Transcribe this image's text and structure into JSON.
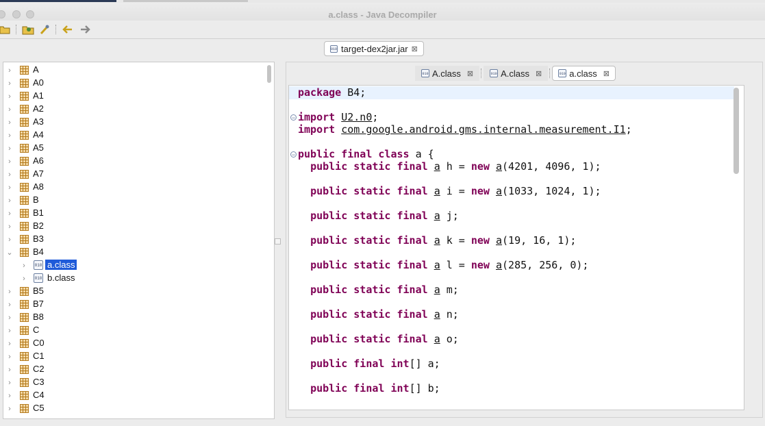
{
  "window": {
    "title": "a.class - Java Decompiler"
  },
  "toolbar": {
    "icons": [
      "open-folder-icon",
      "open-type-icon",
      "open-type-hierarchy-icon",
      "back-arrow-icon",
      "forward-arrow-icon"
    ]
  },
  "file_tab": {
    "label": "target-dex2jar.jar",
    "icon": "jar-icon"
  },
  "tree": {
    "items": [
      {
        "label": "A",
        "expanded": false
      },
      {
        "label": "A0",
        "expanded": false
      },
      {
        "label": "A1",
        "expanded": false
      },
      {
        "label": "A2",
        "expanded": false
      },
      {
        "label": "A3",
        "expanded": false
      },
      {
        "label": "A4",
        "expanded": false
      },
      {
        "label": "A5",
        "expanded": false
      },
      {
        "label": "A6",
        "expanded": false
      },
      {
        "label": "A7",
        "expanded": false
      },
      {
        "label": "A8",
        "expanded": false
      },
      {
        "label": "B",
        "expanded": false
      },
      {
        "label": "B1",
        "expanded": false
      },
      {
        "label": "B2",
        "expanded": false
      },
      {
        "label": "B3",
        "expanded": false
      },
      {
        "label": "B4",
        "expanded": true
      },
      {
        "label": "a.class",
        "child": true,
        "selected": true
      },
      {
        "label": "b.class",
        "child": true,
        "selected": false
      },
      {
        "label": "B5",
        "expanded": false
      },
      {
        "label": "B7",
        "expanded": false
      },
      {
        "label": "B8",
        "expanded": false
      },
      {
        "label": "C",
        "expanded": false
      },
      {
        "label": "C0",
        "expanded": false
      },
      {
        "label": "C1",
        "expanded": false
      },
      {
        "label": "C2",
        "expanded": false
      },
      {
        "label": "C3",
        "expanded": false
      },
      {
        "label": "C4",
        "expanded": false
      },
      {
        "label": "C5",
        "expanded": false
      }
    ]
  },
  "editor": {
    "tabs": [
      {
        "label": "A.class",
        "active": false
      },
      {
        "label": "A.class",
        "active": false
      },
      {
        "label": "a.class",
        "active": true
      }
    ],
    "code_lines": [
      [
        {
          "t": "package",
          "c": "kw"
        },
        {
          "t": " B4;",
          "c": ""
        }
      ],
      [],
      [
        {
          "t": "import",
          "c": "kw"
        },
        {
          "t": " ",
          "c": ""
        },
        {
          "t": "U2.n0",
          "c": "u"
        },
        {
          "t": ";",
          "c": ""
        }
      ],
      [
        {
          "t": "import",
          "c": "kw"
        },
        {
          "t": " ",
          "c": ""
        },
        {
          "t": "com.google.android.gms.internal.measurement.I1",
          "c": "u"
        },
        {
          "t": ";",
          "c": ""
        }
      ],
      [],
      [
        {
          "t": "public final class",
          "c": "kw"
        },
        {
          "t": " a {",
          "c": ""
        }
      ],
      [
        {
          "t": "  ",
          "c": ""
        },
        {
          "t": "public static final",
          "c": "kw"
        },
        {
          "t": " ",
          "c": ""
        },
        {
          "t": "a",
          "c": "u"
        },
        {
          "t": " h = ",
          "c": ""
        },
        {
          "t": "new",
          "c": "kw"
        },
        {
          "t": " ",
          "c": ""
        },
        {
          "t": "a",
          "c": "u"
        },
        {
          "t": "(4201, 4096, 1);",
          "c": ""
        }
      ],
      [],
      [
        {
          "t": "  ",
          "c": ""
        },
        {
          "t": "public static final",
          "c": "kw"
        },
        {
          "t": " ",
          "c": ""
        },
        {
          "t": "a",
          "c": "u"
        },
        {
          "t": " i = ",
          "c": ""
        },
        {
          "t": "new",
          "c": "kw"
        },
        {
          "t": " ",
          "c": ""
        },
        {
          "t": "a",
          "c": "u"
        },
        {
          "t": "(1033, 1024, 1);",
          "c": ""
        }
      ],
      [],
      [
        {
          "t": "  ",
          "c": ""
        },
        {
          "t": "public static final",
          "c": "kw"
        },
        {
          "t": " ",
          "c": ""
        },
        {
          "t": "a",
          "c": "u"
        },
        {
          "t": " j;",
          "c": ""
        }
      ],
      [],
      [
        {
          "t": "  ",
          "c": ""
        },
        {
          "t": "public static final",
          "c": "kw"
        },
        {
          "t": " ",
          "c": ""
        },
        {
          "t": "a",
          "c": "u"
        },
        {
          "t": " k = ",
          "c": ""
        },
        {
          "t": "new",
          "c": "kw"
        },
        {
          "t": " ",
          "c": ""
        },
        {
          "t": "a",
          "c": "u"
        },
        {
          "t": "(19, 16, 1);",
          "c": ""
        }
      ],
      [],
      [
        {
          "t": "  ",
          "c": ""
        },
        {
          "t": "public static final",
          "c": "kw"
        },
        {
          "t": " ",
          "c": ""
        },
        {
          "t": "a",
          "c": "u"
        },
        {
          "t": " l = ",
          "c": ""
        },
        {
          "t": "new",
          "c": "kw"
        },
        {
          "t": " ",
          "c": ""
        },
        {
          "t": "a",
          "c": "u"
        },
        {
          "t": "(285, 256, 0);",
          "c": ""
        }
      ],
      [],
      [
        {
          "t": "  ",
          "c": ""
        },
        {
          "t": "public static final",
          "c": "kw"
        },
        {
          "t": " ",
          "c": ""
        },
        {
          "t": "a",
          "c": "u"
        },
        {
          "t": " m;",
          "c": ""
        }
      ],
      [],
      [
        {
          "t": "  ",
          "c": ""
        },
        {
          "t": "public static final",
          "c": "kw"
        },
        {
          "t": " ",
          "c": ""
        },
        {
          "t": "a",
          "c": "u"
        },
        {
          "t": " n;",
          "c": ""
        }
      ],
      [],
      [
        {
          "t": "  ",
          "c": ""
        },
        {
          "t": "public static final",
          "c": "kw"
        },
        {
          "t": " ",
          "c": ""
        },
        {
          "t": "a",
          "c": "u"
        },
        {
          "t": " o;",
          "c": ""
        }
      ],
      [],
      [
        {
          "t": "  ",
          "c": ""
        },
        {
          "t": "public final",
          "c": "kw"
        },
        {
          "t": " ",
          "c": ""
        },
        {
          "t": "int",
          "c": "kw"
        },
        {
          "t": "[] a;",
          "c": ""
        }
      ],
      [],
      [
        {
          "t": "  ",
          "c": ""
        },
        {
          "t": "public final",
          "c": "kw"
        },
        {
          "t": " ",
          "c": ""
        },
        {
          "t": "int",
          "c": "kw"
        },
        {
          "t": "[] b;",
          "c": ""
        }
      ]
    ]
  },
  "colors": {
    "keyword": "#7f0055",
    "selection": "#1f5bd9",
    "current_line": "#e8f2fe"
  }
}
